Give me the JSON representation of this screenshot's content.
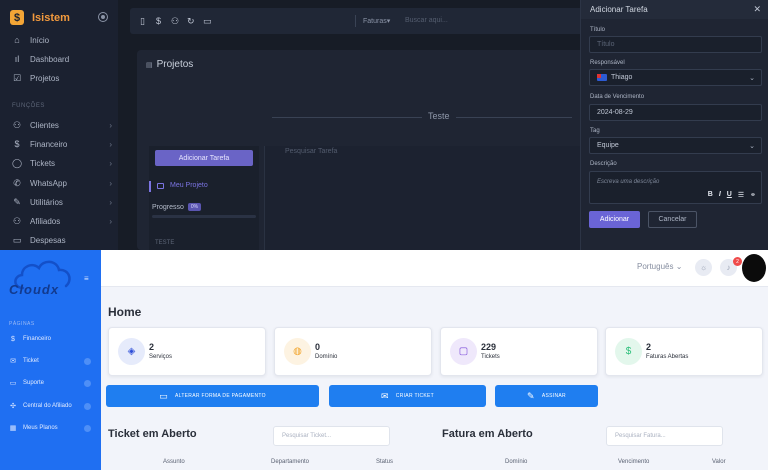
{
  "top_app": {
    "brand": "Isistem",
    "sidebar_items": [
      {
        "icon": "home-icon",
        "label": "Início"
      },
      {
        "icon": "chart-icon",
        "label": "Dashboard"
      },
      {
        "icon": "checklist-icon",
        "label": "Projetos"
      }
    ],
    "sidebar_section": "FUNÇÕES",
    "function_items": [
      {
        "icon": "users-icon",
        "label": "Clientes"
      },
      {
        "icon": "dollar-icon",
        "label": "Financeiro"
      },
      {
        "icon": "chat-icon",
        "label": "Tickets"
      },
      {
        "icon": "whatsapp-icon",
        "label": "WhatsApp"
      },
      {
        "icon": "tools-icon",
        "label": "Utilitários"
      },
      {
        "icon": "affiliates-icon",
        "label": "Afiliados"
      },
      {
        "icon": "wallet-icon",
        "label": "Despesas"
      }
    ],
    "toolbar": {
      "faturas": "Faturas",
      "search_placeholder": "Buscar aqui..."
    },
    "projects": {
      "title": "Projetos",
      "column_title": "Teste",
      "add_task_button": "Adicionar Tarefa",
      "task_search_placeholder": "Pesquisar Tarefa",
      "project_name": "Meu Projeto",
      "progress_label": "Progresso",
      "progress_badge": "0%",
      "progress_value": 0,
      "column_label": "TESTE"
    },
    "modal": {
      "title": "Adicionar Tarefa",
      "fields": {
        "title_label": "Título",
        "title_placeholder": "Título",
        "responsible_label": "Responsável",
        "responsible_value": "Thiago",
        "due_label": "Data de Vencimento",
        "due_value": "2024-08-29",
        "tag_label": "Tag",
        "tag_value": "Equipe",
        "desc_label": "Descrição",
        "desc_placeholder": "Escreva uma descrição"
      },
      "format_buttons": [
        "B",
        "I",
        "U"
      ],
      "add_button": "Adicionar",
      "cancel_button": "Cancelar"
    }
  },
  "bottom_app": {
    "brand": "Cloudx",
    "sidebar_section": "PÁGINAS",
    "sidebar_items": [
      {
        "icon": "dollar-icon",
        "label": "Financeiro"
      },
      {
        "icon": "ticket-icon",
        "label": "Ticket"
      },
      {
        "icon": "support-icon",
        "label": "Suporte"
      },
      {
        "icon": "affiliate-icon",
        "label": "Central do Afiliado"
      },
      {
        "icon": "plans-icon",
        "label": "Meus Planos"
      }
    ],
    "topbar": {
      "language": "Português",
      "notifications_count": "2"
    },
    "home_title": "Home",
    "stats": [
      {
        "icon": "cube-icon",
        "value": "2",
        "label": "Serviços",
        "color": "#2f4fd8",
        "bg": "#e6ebfb"
      },
      {
        "icon": "globe-icon",
        "value": "0",
        "label": "Domínio",
        "color": "#f2a52c",
        "bg": "#fdf3e2"
      },
      {
        "icon": "chat-icon",
        "value": "229",
        "label": "Tickets",
        "color": "#7a48d8",
        "bg": "#efe8fb"
      },
      {
        "icon": "dollar-icon",
        "value": "2",
        "label": "Faturas Abertas",
        "color": "#2bbf7a",
        "bg": "#e3f7ec"
      }
    ],
    "actions": [
      {
        "icon": "card-icon",
        "label": "ALTERAR FORMA DE PAGAMENTO"
      },
      {
        "icon": "mail-icon",
        "label": "CRIAR TICKET"
      },
      {
        "icon": "pen-icon",
        "label": "ASSINAR"
      }
    ],
    "open_tickets": {
      "title": "Ticket em Aberto",
      "search_placeholder": "Pesquisar Ticket...",
      "columns": [
        "Assunto",
        "Departamento",
        "Status"
      ]
    },
    "open_invoices": {
      "title": "Fatura em Aberto",
      "search_placeholder": "Pesquisar Fatura...",
      "columns": [
        "Domínio",
        "Vencimento",
        "Valor"
      ]
    }
  }
}
